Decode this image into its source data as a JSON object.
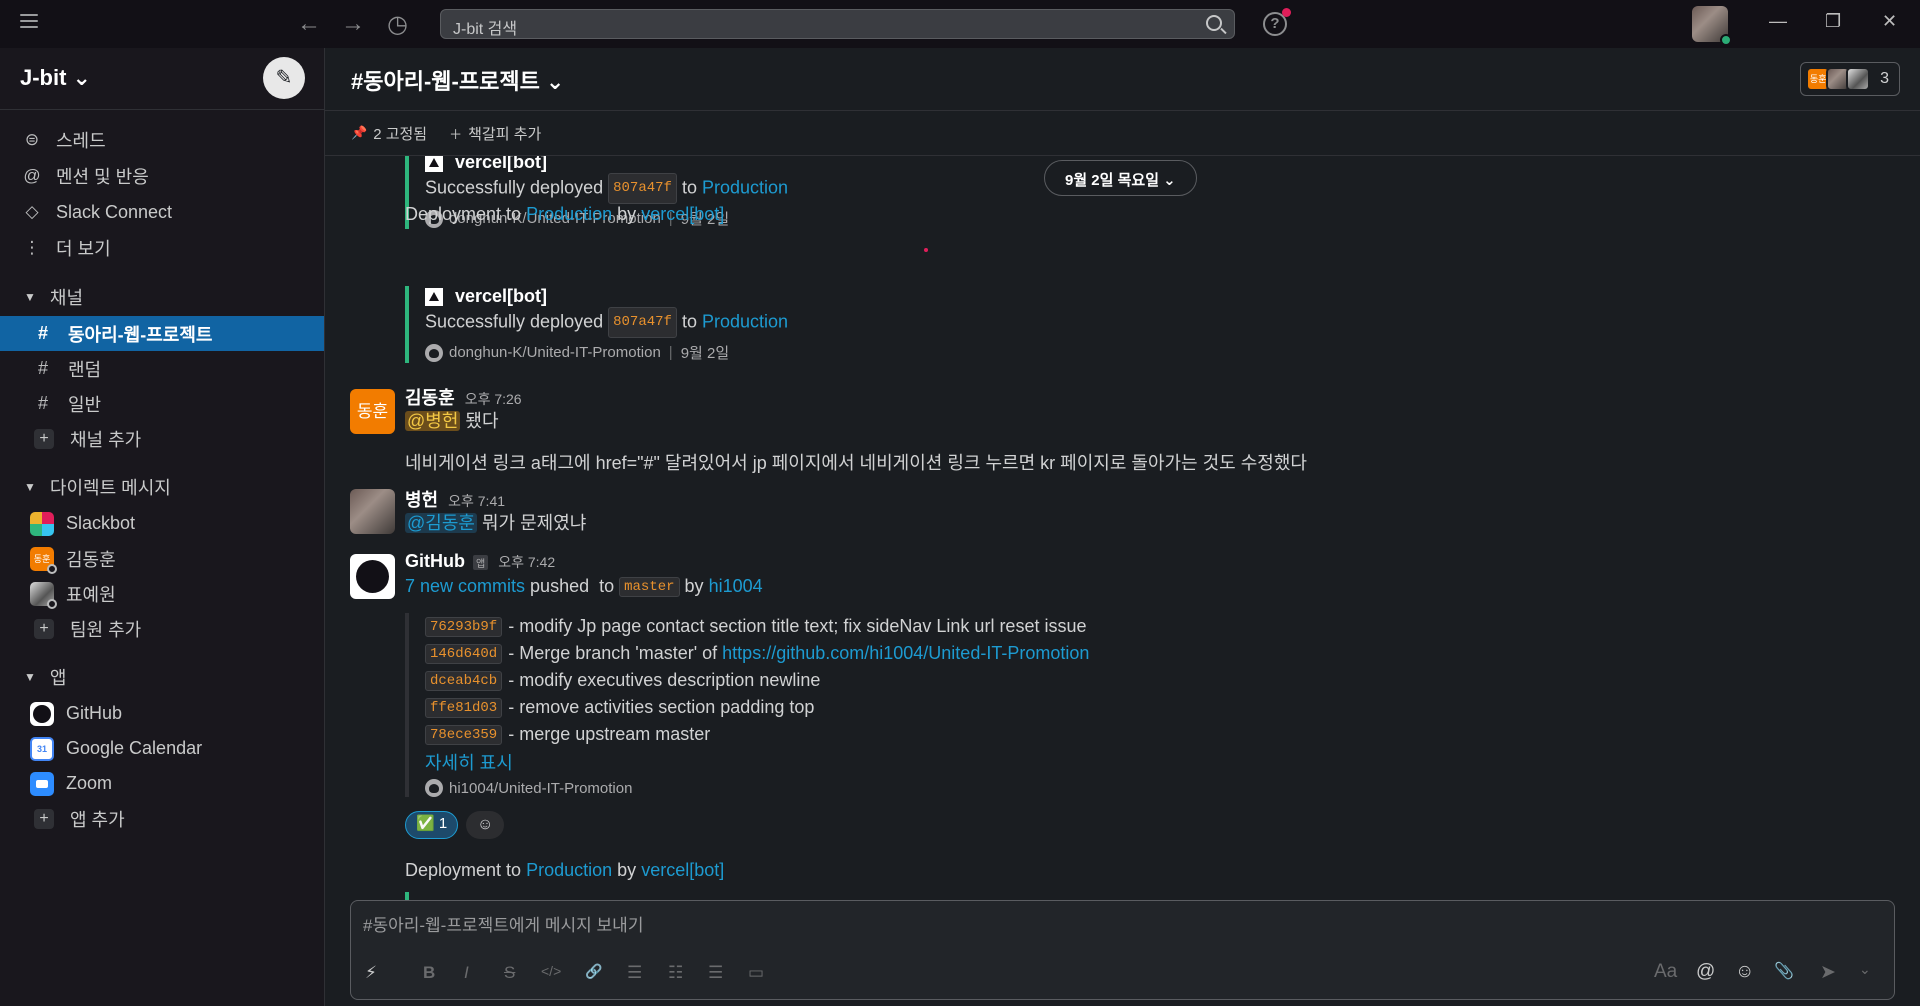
{
  "topbar": {
    "search_placeholder": "J-bit 검색",
    "back": "←",
    "forward": "→",
    "history": "◷",
    "help": "?",
    "minimize": "—",
    "restore": "❐",
    "close": "✕"
  },
  "sidebar": {
    "workspace": "J-bit ⌄",
    "compose_icon": "✎",
    "nav": [
      {
        "icon": "⊜",
        "label": "스레드"
      },
      {
        "icon": "@",
        "label": "멘션 및 반응"
      },
      {
        "icon": "◇",
        "label": "Slack Connect"
      },
      {
        "icon": "⋮",
        "label": "더 보기"
      }
    ],
    "channels_title": "채널",
    "channels": [
      {
        "name": "동아리-웹-프로젝트",
        "active": true
      },
      {
        "name": "랜덤"
      },
      {
        "name": "일반"
      }
    ],
    "add_channel": "채널 추가",
    "dm_title": "다이렉트 메시지",
    "dms": [
      {
        "name": "Slackbot",
        "avatar_text": ""
      },
      {
        "name": "김동훈",
        "avatar_text": "동훈"
      },
      {
        "name": "표예원",
        "avatar_text": ""
      }
    ],
    "add_member": "팀원 추가",
    "apps_title": "앱",
    "apps": [
      {
        "name": "GitHub"
      },
      {
        "name": "Google Calendar",
        "icon_text": "31"
      },
      {
        "name": "Zoom"
      }
    ],
    "add_app": "앱 추가"
  },
  "channel": {
    "title": "#동아리-웹-프로젝트 ⌄",
    "member_avatar_text": "동훈",
    "member_count": "3",
    "pinned": "2 고정됨",
    "add_bookmark": "책갈피 추가"
  },
  "messages": {
    "date_pill": "9월 2일 목요일 ⌄",
    "deploy1": {
      "bot": "vercel[bot]",
      "text_pre": "Successfully deployed",
      "commit": "807a47f",
      "to": "to",
      "env": "Production",
      "repo": "donghun-K/United-IT-Promotion",
      "date": "9월 2일"
    },
    "sys1": {
      "a": "Deployment to",
      "env": "Production",
      "by": "by",
      "bot": "vercel[bot]"
    },
    "deploy2": {
      "bot": "vercel[bot]",
      "text_pre": "Successfully deployed",
      "commit": "807a47f",
      "to": "to",
      "env": "Production",
      "repo": "donghun-K/United-IT-Promotion",
      "date": "9월 2일"
    },
    "msg1": {
      "avatar_text": "동훈",
      "name": "김동훈",
      "time": "오후 7:26",
      "mention": "@병헌",
      "text1": " 됐다",
      "text2": "네비게이션 링크 a태그에 href=\"#\" 달려있어서 jp 페이지에서 네비게이션 링크 누르면 kr 페이지로 돌아가는 것도 수정했다"
    },
    "msg2": {
      "name": "병헌",
      "time": "오후 7:41",
      "mention": "@김동훈",
      "text": " 뭐가 문제였냐"
    },
    "msg3": {
      "name": "GitHub",
      "app_badge": "앱",
      "time": "오후 7:42",
      "commits_link": "7 new commits",
      "pushed": " pushed  to ",
      "branch": "master",
      "by": " by ",
      "user": "hi1004",
      "commits": [
        {
          "hash": "76293b9f",
          "text": "- modify Jp page contact section title text; fix sideNav Link url reset issue"
        },
        {
          "hash": "146d640d",
          "text": "- Merge branch 'master' of ",
          "link": "https://github.com/hi1004/United-IT-Promotion"
        },
        {
          "hash": "dceab4cb",
          "text": "- modify executives description newline"
        },
        {
          "hash": "ffe81d03",
          "text": "- remove activities section padding top"
        },
        {
          "hash": "78ece359",
          "text": "- merge upstream master"
        }
      ],
      "show_more": "자세히 표시",
      "repo": "hi1004/United-IT-Promotion",
      "reaction": "✅ 1",
      "add_reaction": "☺"
    },
    "sys2": {
      "a": "Deployment to",
      "env": "Production",
      "by": "by",
      "bot": "vercel[bot]"
    }
  },
  "composer": {
    "placeholder": "#동아리-웹-프로젝트에게 메시지 보내기",
    "tools": [
      "⚡",
      "B",
      "I",
      "S",
      "</>",
      "🔗",
      "☰",
      "☷",
      "☰",
      "▭"
    ],
    "right_tools": [
      "Aa",
      "@",
      "☺",
      "📎",
      "➤",
      "⌄"
    ]
  },
  "colors": {
    "accent": "#1164a3",
    "link": "#1d9bd1",
    "attachment_bar": "#2eb67d",
    "code": "#e8912d",
    "avatar_orange": "#f27c00"
  }
}
